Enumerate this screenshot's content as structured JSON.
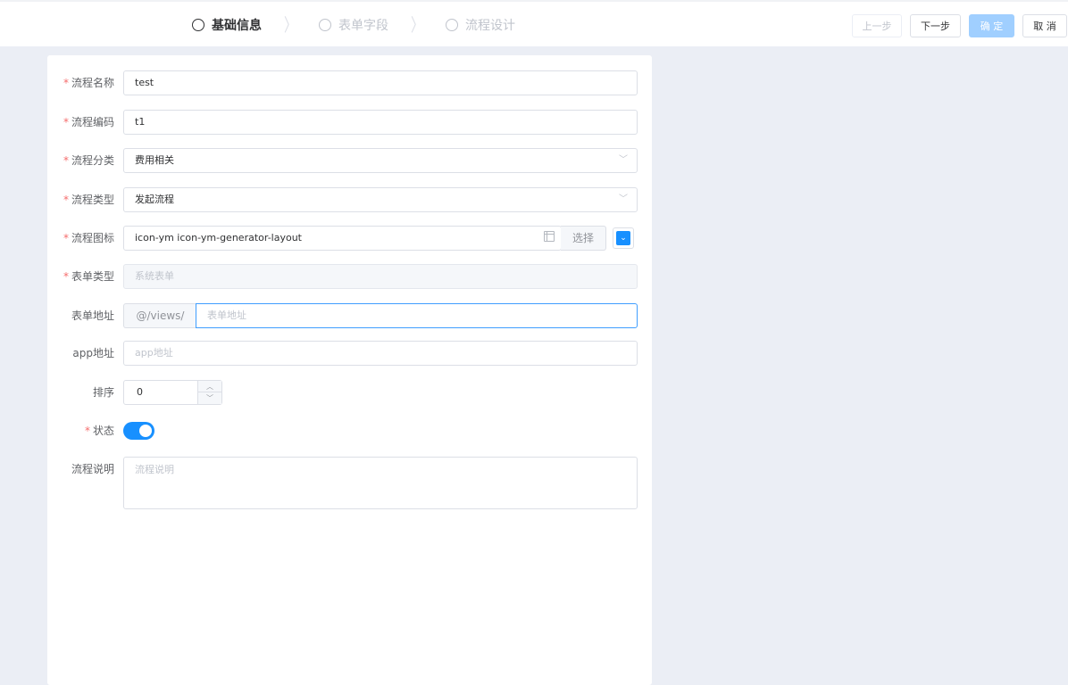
{
  "steps": [
    {
      "label": "基础信息",
      "active": true
    },
    {
      "label": "表单字段",
      "active": false
    },
    {
      "label": "流程设计",
      "active": false
    }
  ],
  "toolbar": {
    "prev_label": "上一步",
    "next_label": "下一步",
    "confirm_label": "确 定",
    "cancel_label": "取 消"
  },
  "form": {
    "name": {
      "label": "流程名称",
      "value": "test",
      "required": true
    },
    "code": {
      "label": "流程编码",
      "value": "t1",
      "required": true
    },
    "category": {
      "label": "流程分类",
      "value": "费用相关",
      "required": true
    },
    "type": {
      "label": "流程类型",
      "value": "发起流程",
      "required": true
    },
    "icon": {
      "label": "流程图标",
      "value": "icon-ym icon-ym-generator-layout",
      "select_label": "选择",
      "color": "#1890ff",
      "required": true
    },
    "form_type": {
      "label": "表单类型",
      "value": "系统表单",
      "required": true
    },
    "form_address": {
      "label": "表单地址",
      "prefix": "@/views/",
      "placeholder": "表单地址"
    },
    "app_address": {
      "label": "app地址",
      "placeholder": "app地址"
    },
    "sort": {
      "label": "排序",
      "value": "0"
    },
    "status": {
      "label": "状态",
      "on": true,
      "required": true
    },
    "description": {
      "label": "流程说明",
      "placeholder": "流程说明"
    }
  },
  "colors": {
    "primary": "#1890ff",
    "required": "#f56c6c",
    "focus": "#409eff"
  }
}
